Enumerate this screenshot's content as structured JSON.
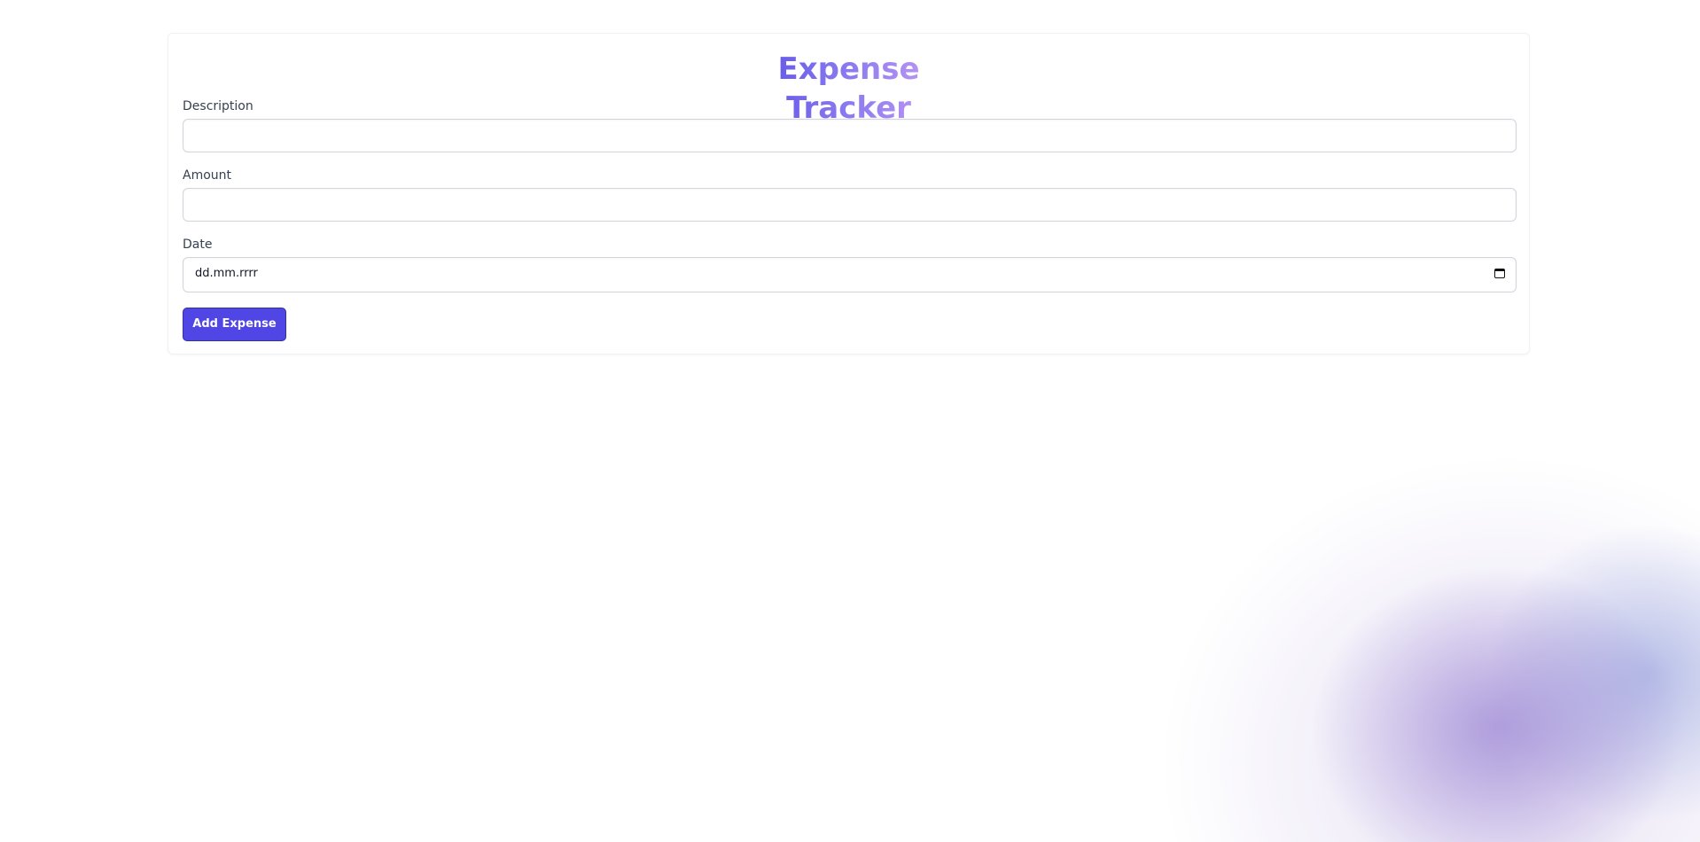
{
  "app": {
    "title": "Expense Tracker"
  },
  "form": {
    "description": {
      "label": "Description",
      "value": ""
    },
    "amount": {
      "label": "Amount",
      "value": ""
    },
    "date": {
      "label": "Date",
      "display": "dd.mm.rrrr",
      "icon": "calendar-icon"
    },
    "submit_label": "Add Expense"
  },
  "colors": {
    "accent": "#4f46e5",
    "title_gradient_start": "#4f46e5",
    "title_gradient_end": "#d8a4f5"
  }
}
